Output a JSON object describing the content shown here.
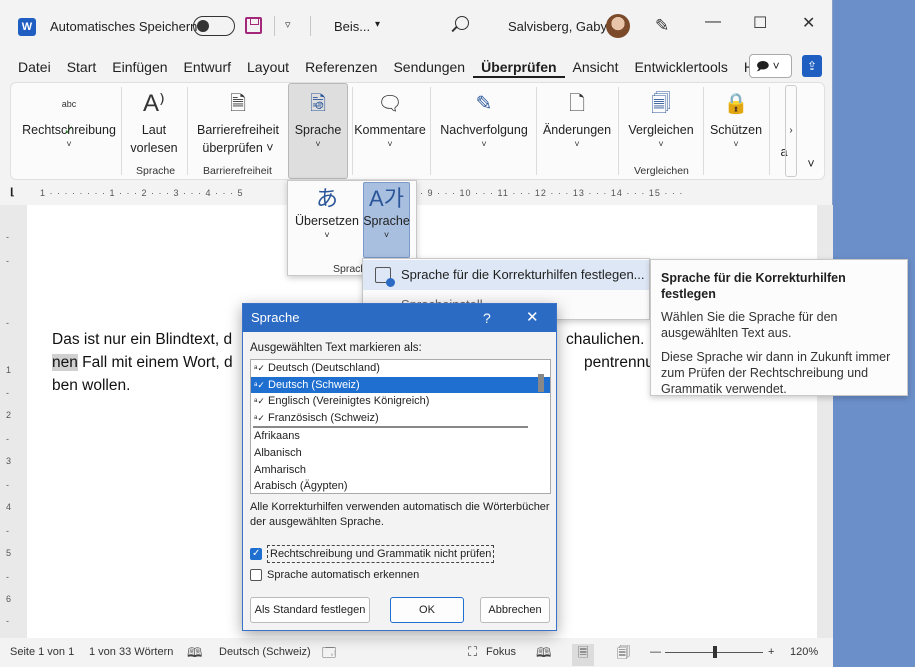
{
  "titlebar": {
    "app_icon_letter": "W",
    "autosave_label": "Automatisches Speichern",
    "document_title": "Beis...",
    "user_name": "Salvisberg, Gaby",
    "minimize": "—",
    "maximize": "☐",
    "close": "✕"
  },
  "tabs": [
    "Datei",
    "Start",
    "Einfügen",
    "Entwurf",
    "Layout",
    "Referenzen",
    "Sendungen",
    "Überprüfen",
    "Ansicht",
    "Entwicklertools",
    "Hilfe"
  ],
  "active_tab": "Überprüfen",
  "ribbon": {
    "spelling": "Rechtschreibung",
    "read_aloud_1": "Laut",
    "read_aloud_2": "vorlesen",
    "accessibility_1": "Barrierefreiheit",
    "accessibility_2": "überprüfen ˅",
    "language": "Sprache",
    "comments": "Kommentare",
    "tracking": "Nachverfolgung",
    "changes": "Änderungen",
    "compare": "Vergleichen",
    "protect": "Schützen",
    "group_language": "Sprache",
    "group_accessibility": "Barrierefreiheit",
    "group_compare": "Vergleichen",
    "overflow_a": "a",
    "icon_abc": "abc"
  },
  "ruler": "1 · · · · · · · · 1 · · · 2 · · · 3 · · · 4 · · · 5",
  "ruler_right": "· 9 · · · 10 · · · 11 · · · 12 · · · 13 · · · 14 · · · 15 · · ·",
  "vruler": [
    "-",
    "-",
    "-",
    "1",
    "-",
    "2",
    "-",
    "3",
    "-",
    "4",
    "-",
    "5",
    "-",
    "6",
    "-"
  ],
  "document": {
    "line1": "Das ist nur ein Blindtext, d",
    "line1_right": "chaulichen. H",
    "line2_hl": "nen",
    "line2": " Fall mit einem Wort, d",
    "line2_right": "pentrennung",
    "line3": "ben wollen."
  },
  "gallery": {
    "translate": "Übersetzen",
    "language": "Sprache",
    "group_label": "Sprach"
  },
  "menu": {
    "item1": "Sprache für die Korrekturhilfen festlegen...",
    "item2": "Spracheinstell..."
  },
  "tooltip": {
    "title": "Sprache für die Korrekturhilfen festlegen",
    "p1": "Wählen Sie die Sprache für den ausgewählten Text aus.",
    "p2": "Diese Sprache wir dann in Zukunft immer zum Prüfen der Rechtschreibung und Grammatik verwendet."
  },
  "dialog": {
    "title": "Sprache",
    "help": "?",
    "close": "✕",
    "label": "Ausgewählten Text markieren als:",
    "languages_top": [
      {
        "name": "Deutsch (Deutschland)",
        "selected": false
      },
      {
        "name": "Deutsch (Schweiz)",
        "selected": true
      },
      {
        "name": "Englisch (Vereinigtes Königreich)",
        "selected": false
      },
      {
        "name": "Französisch (Schweiz)",
        "selected": false
      }
    ],
    "languages_rest": [
      "Afrikaans",
      "Albanisch",
      "Amharisch",
      "Arabisch (Ägypten)"
    ],
    "description": "Alle Korrekturhilfen verwenden automatisch die Wörterbücher der ausgewählten Sprache.",
    "check_no_proof": "Rechtschreibung und Grammatik nicht prüfen",
    "check_no_proof_checked": true,
    "check_auto_detect": "Sprache automatisch erkennen",
    "check_auto_detect_checked": false,
    "btn_default": "Als Standard festlegen",
    "btn_ok": "OK",
    "btn_cancel": "Abbrechen"
  },
  "statusbar": {
    "page": "Seite 1 von 1",
    "words": "1 von 33 Wörtern",
    "language": "Deutsch (Schweiz)",
    "focus": "Fokus",
    "zoom_minus": "—",
    "zoom_plus": "+",
    "zoom": "120%"
  },
  "colors": {
    "accent": "#2b6bc4",
    "selection": "#1e6fd0",
    "save_icon": "#a4287a",
    "desktop": "#6b8fc9"
  }
}
